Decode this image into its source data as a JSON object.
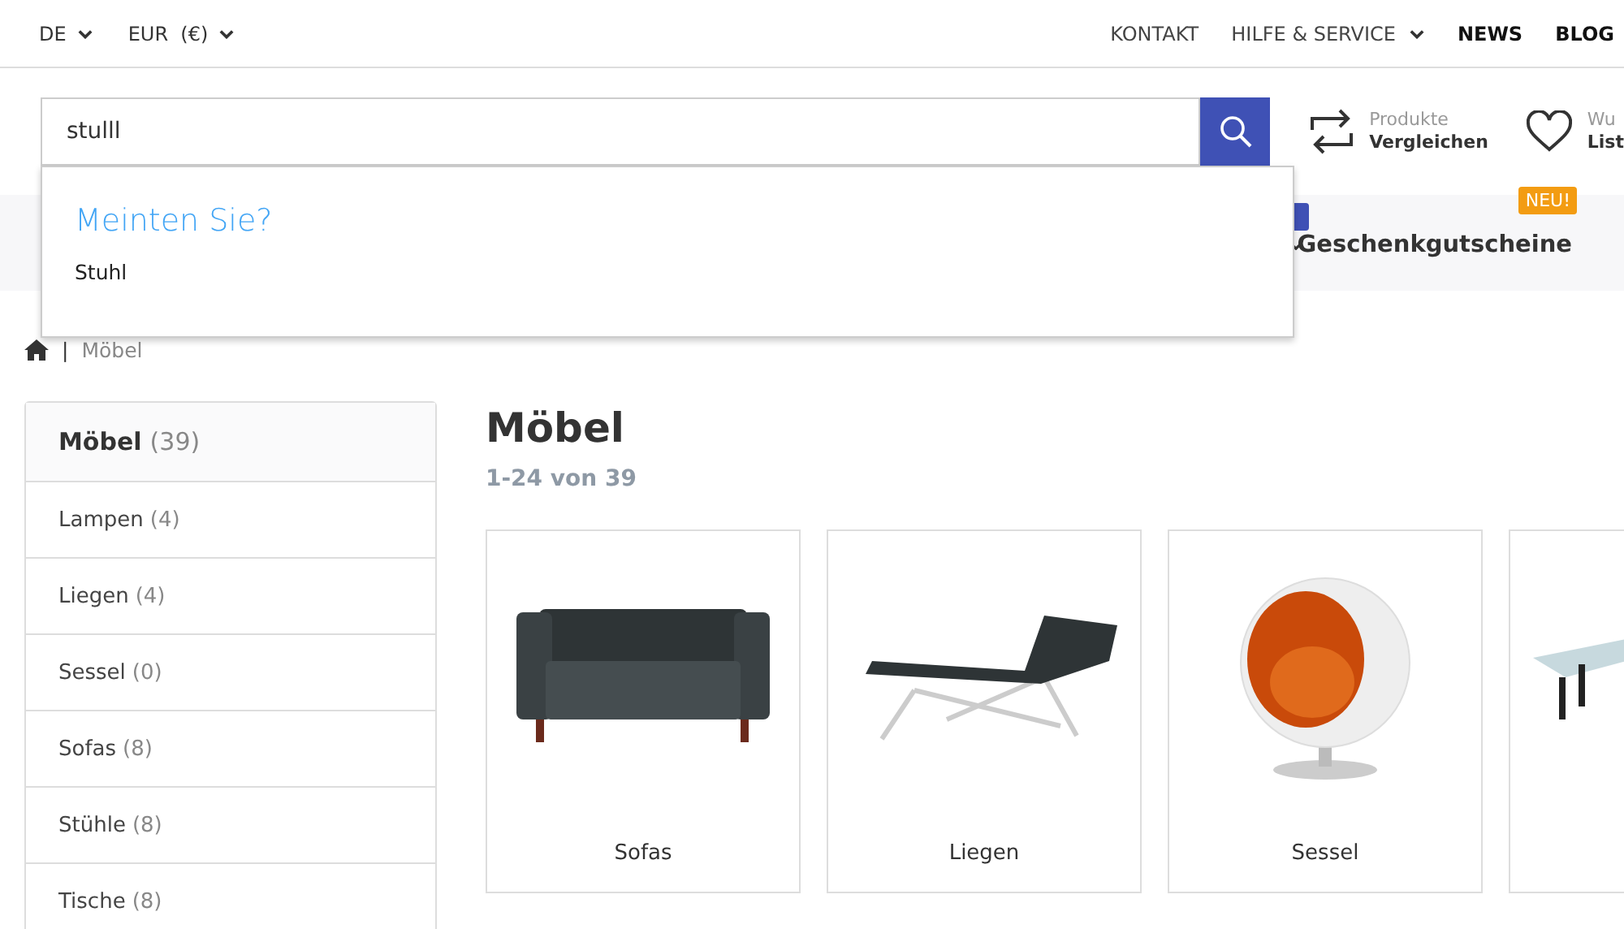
{
  "topbar": {
    "language": "DE",
    "currency": "EUR  (€)",
    "links": [
      {
        "label": "KONTAKT",
        "kind": "plain"
      },
      {
        "label": "HILFE & SERVICE",
        "kind": "dropdown"
      },
      {
        "label": "NEWS",
        "kind": "strong"
      },
      {
        "label": "BLOG",
        "kind": "strong"
      }
    ]
  },
  "search": {
    "value": "stulll",
    "suggestions_title": "Meinten Sie?",
    "suggestions": [
      "Stuhl"
    ]
  },
  "header_actions": [
    {
      "kind": "compare",
      "line1": "Produkte",
      "line2": "Vergleichen"
    },
    {
      "kind": "wishlist",
      "line1": "Wu",
      "line2": "List"
    }
  ],
  "nav": {
    "items": [
      {
        "label": "Geschenkgutscheine",
        "badge": "NEU!"
      }
    ]
  },
  "breadcrumb": {
    "separator": "|",
    "items": [
      "Möbel"
    ]
  },
  "sidebar": {
    "title": "Möbel",
    "count": "(39)",
    "items": [
      {
        "label": "Lampen",
        "count": "(4)"
      },
      {
        "label": "Liegen",
        "count": "(4)"
      },
      {
        "label": "Sessel",
        "count": "(0)"
      },
      {
        "label": "Sofas",
        "count": "(8)"
      },
      {
        "label": "Stühle",
        "count": "(8)"
      },
      {
        "label": "Tische",
        "count": "(8)"
      }
    ]
  },
  "main": {
    "title": "Möbel",
    "result_count": "1-24 von 39"
  },
  "products": [
    {
      "kind": "sofa",
      "name": "Sofas"
    },
    {
      "kind": "lounger",
      "name": "Liegen"
    },
    {
      "kind": "ballchair",
      "name": "Sessel"
    },
    {
      "kind": "table"
    }
  ]
}
